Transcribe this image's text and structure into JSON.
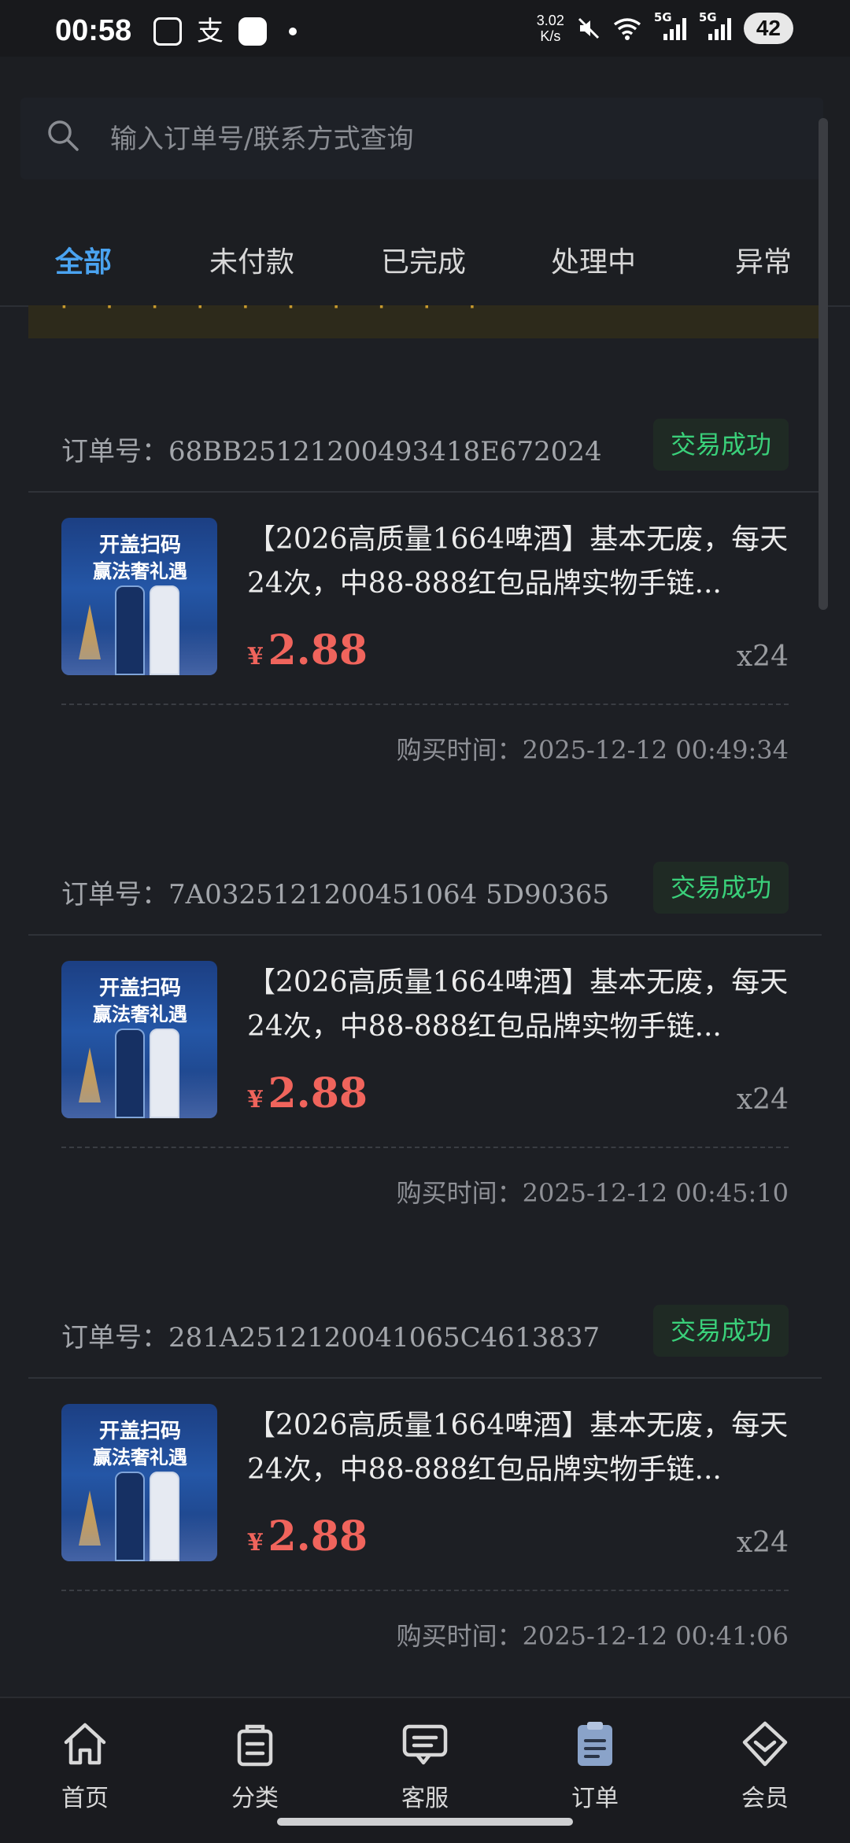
{
  "status_bar": {
    "time": "00:58",
    "net_speed_value": "3.02",
    "net_speed_unit": "K/s",
    "battery": "42",
    "network_1": "5G",
    "network_2": "5G"
  },
  "search": {
    "placeholder": "输入订单号/联系方式查询"
  },
  "tabs": [
    {
      "label": "全部",
      "active": true
    },
    {
      "label": "未付款",
      "active": false
    },
    {
      "label": "已完成",
      "active": false
    },
    {
      "label": "处理中",
      "active": false
    },
    {
      "label": "异常",
      "active": false
    }
  ],
  "orders": [
    {
      "order_no": "订单号：68BB25121200493418E672024",
      "status": "交易成功",
      "thumb_line1": "开盖扫码",
      "thumb_line2": "赢法奢礼遇",
      "title": "【2026高质量1664啤酒】基本无废，每天24次，中88-888红包品牌实物手链...",
      "currency": "¥",
      "price": "2.88",
      "qty": "x24",
      "buy_time": "购买时间：2025-12-12 00:49:34"
    },
    {
      "order_no": "订单号：7A0325121200451064 5D90365",
      "status": "交易成功",
      "thumb_line1": "开盖扫码",
      "thumb_line2": "赢法奢礼遇",
      "title": "【2026高质量1664啤酒】基本无废，每天24次，中88-888红包品牌实物手链...",
      "currency": "¥",
      "price": "2.88",
      "qty": "x24",
      "buy_time": "购买时间：2025-12-12 00:45:10"
    },
    {
      "order_no": "订单号：281A2512120041065C4613837",
      "status": "交易成功",
      "thumb_line1": "开盖扫码",
      "thumb_line2": "赢法奢礼遇",
      "title": "【2026高质量1664啤酒】基本无废，每天24次，中88-888红包品牌实物手链...",
      "currency": "¥",
      "price": "2.88",
      "qty": "x24",
      "buy_time": "购买时间：2025-12-12 00:41:06"
    }
  ],
  "bottom_nav": [
    {
      "label": "首页",
      "icon": "home-icon"
    },
    {
      "label": "分类",
      "icon": "bag-icon"
    },
    {
      "label": "客服",
      "icon": "chat-icon"
    },
    {
      "label": "订单",
      "icon": "clipboard-icon",
      "active": true
    },
    {
      "label": "会员",
      "icon": "diamond-icon"
    }
  ],
  "colors": {
    "accent": "#4aa3f0",
    "success": "#3ad07a",
    "price": "#f0645c",
    "background": "#1d1f24"
  }
}
